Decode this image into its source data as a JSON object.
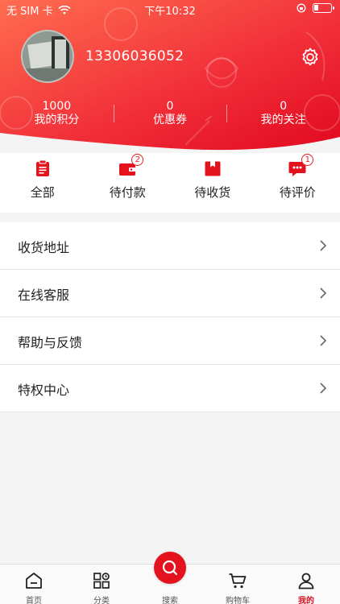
{
  "status_bar": {
    "carrier": "无 SIM 卡",
    "time": "下午10:32",
    "battery_level": 0.25
  },
  "profile": {
    "phone": "13306036052"
  },
  "stats": [
    {
      "value": "1000",
      "label": "我的积分"
    },
    {
      "value": "0",
      "label": "优惠券"
    },
    {
      "value": "0",
      "label": "我的关注"
    }
  ],
  "orders": [
    {
      "label": "全部",
      "icon": "clipboard-icon"
    },
    {
      "label": "待付款",
      "icon": "wallet-icon",
      "badge": "2"
    },
    {
      "label": "待收货",
      "icon": "box-icon"
    },
    {
      "label": "待评价",
      "icon": "comment-icon",
      "badge": "1"
    }
  ],
  "menu": [
    {
      "label": "收货地址"
    },
    {
      "label": "在线客服"
    },
    {
      "label": "帮助与反馈"
    },
    {
      "label": "特权中心"
    }
  ],
  "tabs": [
    {
      "label": "首页",
      "icon": "home-icon"
    },
    {
      "label": "分类",
      "icon": "category-icon"
    },
    {
      "label": "搜索",
      "icon": "search-icon"
    },
    {
      "label": "购物车",
      "icon": "cart-icon"
    },
    {
      "label": "我的",
      "icon": "user-icon",
      "active": true
    }
  ],
  "colors": {
    "brand_red": "#e3121d",
    "header_gradient_start": "#ff6b4e",
    "header_gradient_end": "#e50d24"
  }
}
